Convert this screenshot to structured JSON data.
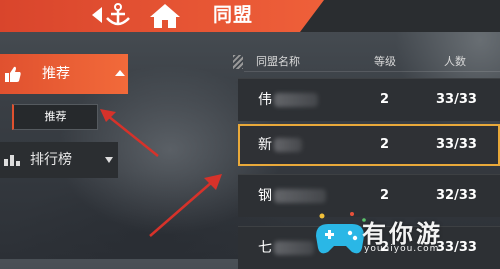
{
  "header": {
    "title": "同盟"
  },
  "sidebar": {
    "recommend_label": "推荐",
    "recommend_sub_label": "推荐",
    "ranking_label": "排行榜"
  },
  "list": {
    "columns": [
      "同盟名称",
      "等级",
      "人数"
    ],
    "rows": [
      {
        "name_first": "伟",
        "level": "2",
        "members": "33/33"
      },
      {
        "name_first": "新",
        "level": "2",
        "members": "33/33"
      },
      {
        "name_first": "钢",
        "level": "2",
        "members": "32/33"
      },
      {
        "name_first": "七",
        "level": "2",
        "members": "33/33"
      }
    ]
  },
  "watermark": {
    "brand": "有你游",
    "url": "youniyou.com"
  },
  "colors": {
    "accent_orange": "#f0613a",
    "highlight_gold": "#e9a93a",
    "annotation_red": "#d6322a"
  },
  "icons": {
    "back": "anchor-back-icon",
    "home": "home-icon",
    "recommend": "thumbs-up-icon",
    "ranking": "ranking-bars-icon"
  }
}
